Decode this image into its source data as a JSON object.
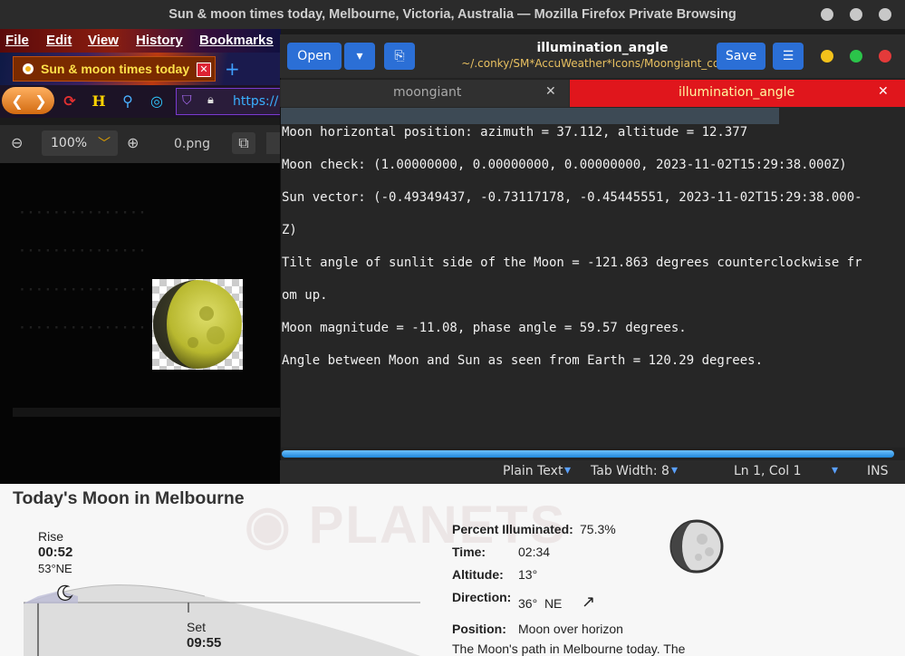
{
  "firefox": {
    "window_title": "Sun & moon times today, Melbourne, Victoria, Australia — Mozilla Firefox Private Browsing",
    "menu": [
      "File",
      "Edit",
      "View",
      "History",
      "Bookmarks"
    ],
    "tab_title": "Sun & moon times today",
    "url_fragment": "https://",
    "zoom": "100%",
    "image_filename": "0.png"
  },
  "gedit": {
    "open_label": "Open",
    "save_label": "Save",
    "title": "illumination_angle",
    "subtitle": "~/.conky/SM*AccuWeather*Icons/Moongiant_conk…",
    "tabs": [
      "moongiant",
      "illumination_angle"
    ],
    "lines": [
      "Moon horizontal position: azimuth = 37.112, altitude = 12.377",
      "Moon check: (1.00000000, 0.00000000, 0.00000000, 2023-11-02T15:29:38.000Z)",
      "Sun vector: (-0.49349437, -0.73117178, -0.45445551, 2023-11-02T15:29:38.000-",
      "Z)",
      "Tilt angle of sunlit side of the Moon = -121.863 degrees counterclockwise fr",
      "om up.",
      "Moon magnitude = -11.08, phase angle = 59.57 degrees.",
      "Angle between Moon and Sun as seen from Earth = 120.29 degrees."
    ],
    "status": {
      "syntax": "Plain Text",
      "tab_width": "Tab Width: 8",
      "position": "Ln 1, Col 1",
      "mode": "INS"
    }
  },
  "web": {
    "heading": "Today's Moon in Melbourne",
    "rise_label": "Rise",
    "rise_time": "00:52",
    "rise_dir": "53°NE",
    "set_label": "Set",
    "set_time": "09:55",
    "percent_label": "Percent Illuminated:",
    "percent_value": "75.3%",
    "time_label": "Time:",
    "time_value": "02:34",
    "altitude_label": "Altitude:",
    "altitude_value": "13°",
    "direction_label": "Direction:",
    "direction_value": "36°  NE",
    "position_label": "Position:",
    "position_value": "Moon over horizon",
    "paragraph": "The Moon's path in Melbourne today. The"
  },
  "colors": {
    "accent_blue": "#2b6fd6",
    "active_tab_red": "#e0161c",
    "highlight_text": "#fff8a0"
  }
}
